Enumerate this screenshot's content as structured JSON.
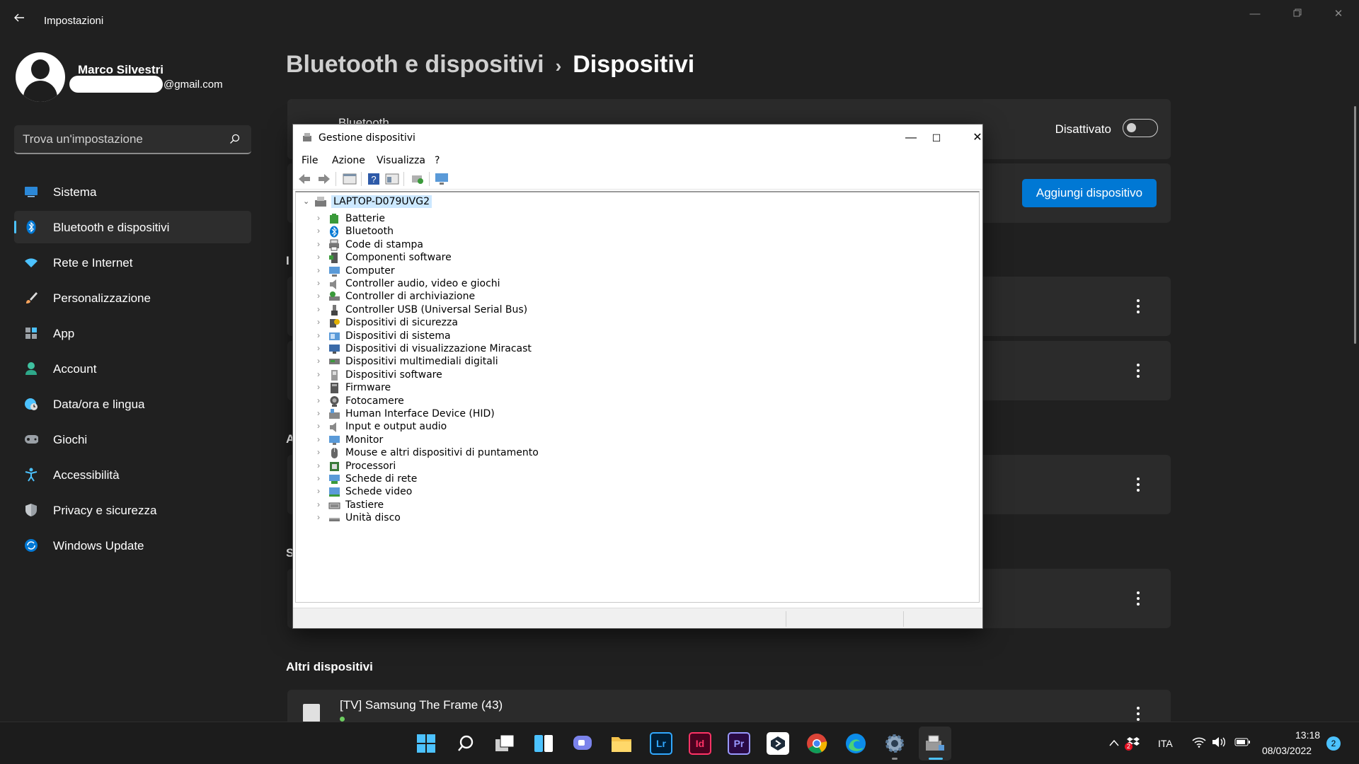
{
  "app": {
    "title": "Impostazioni"
  },
  "profile": {
    "name": "Marco Silvestri",
    "email_domain": "@gmail.com"
  },
  "search": {
    "placeholder": "Trova un'impostazione"
  },
  "sidebar": {
    "items": [
      {
        "label": "Sistema",
        "icon": "monitor-icon",
        "color": "#2b88d8"
      },
      {
        "label": "Bluetooth e dispositivi",
        "icon": "bluetooth-icon",
        "color": "#0078d4",
        "active": true
      },
      {
        "label": "Rete e Internet",
        "icon": "wifi-icon",
        "color": "#4cc2ff"
      },
      {
        "label": "Personalizzazione",
        "icon": "brush-icon",
        "color": "#f7a35c"
      },
      {
        "label": "App",
        "icon": "apps-icon",
        "color": "#9aa0a6"
      },
      {
        "label": "Account",
        "icon": "person-icon",
        "color": "#3fc1a0"
      },
      {
        "label": "Data/ora e lingua",
        "icon": "globe-clock-icon",
        "color": "#4cc2ff"
      },
      {
        "label": "Giochi",
        "icon": "gamepad-icon",
        "color": "#9aa0a6"
      },
      {
        "label": "Accessibilità",
        "icon": "accessibility-icon",
        "color": "#4cc2ff"
      },
      {
        "label": "Privacy e sicurezza",
        "icon": "shield-icon",
        "color": "#9aa0a6"
      },
      {
        "label": "Windows Update",
        "icon": "update-icon",
        "color": "#4cc2ff"
      }
    ]
  },
  "breadcrumb": {
    "parent": "Bluetooth e dispositivi",
    "separator": "›",
    "current": "Dispositivi"
  },
  "bluetooth": {
    "label": "Bluetooth",
    "state": "Disattivato",
    "on": false
  },
  "add_device": {
    "label": "Aggiungi dispositivo"
  },
  "sections": {
    "s1": "I",
    "s2": "A",
    "s3": "S",
    "other": "Altri dispositivi"
  },
  "other_devices": [
    {
      "name": "[TV] Samsung The Frame (43)"
    }
  ],
  "device_manager": {
    "title": "Gestione dispositivi",
    "menu": [
      "File",
      "Azione",
      "Visualizza",
      "?"
    ],
    "root": "LAPTOP-D079UVG2",
    "categories": [
      "Batterie",
      "Bluetooth",
      "Code di stampa",
      "Componenti software",
      "Computer",
      "Controller audio, video e giochi",
      "Controller di archiviazione",
      "Controller USB (Universal Serial Bus)",
      "Dispositivi di sicurezza",
      "Dispositivi di sistema",
      "Dispositivi di visualizzazione Miracast",
      "Dispositivi multimediali digitali",
      "Dispositivi software",
      "Firmware",
      "Fotocamere",
      "Human Interface Device (HID)",
      "Input e output audio",
      "Monitor",
      "Mouse e altri dispositivi di puntamento",
      "Processori",
      "Schede di rete",
      "Schede video",
      "Tastiere",
      "Unità disco"
    ]
  },
  "taskbar": {
    "apps": [
      "start-icon",
      "search-icon",
      "task-view-icon",
      "widgets-icon",
      "chat-icon",
      "file-explorer-icon",
      "lightroom-icon",
      "indesign-icon",
      "premiere-icon",
      "app-icon",
      "chrome-icon",
      "edge-icon",
      "settings-icon",
      "device-manager-icon"
    ],
    "app_labels": {
      "lightroom": "Lr",
      "indesign": "Id",
      "premiere": "Pr"
    },
    "language": "ITA",
    "time": "13:18",
    "date": "08/03/2022",
    "notifications": "2",
    "tray_badge": "2"
  }
}
